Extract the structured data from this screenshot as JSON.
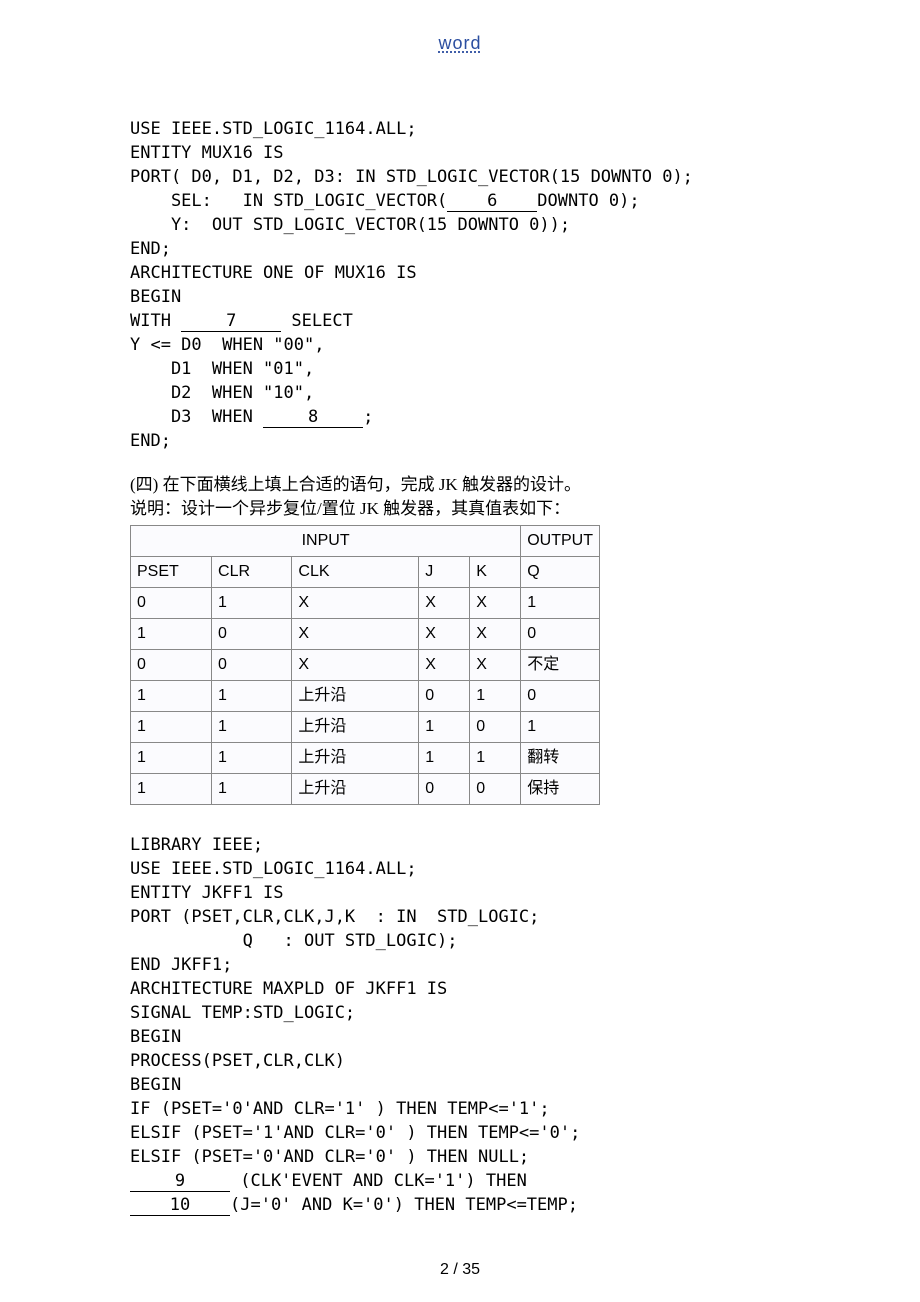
{
  "header": {
    "word": "word"
  },
  "code1": {
    "line1": "USE IEEE.STD_LOGIC_1164.ALL;",
    "line2": "ENTITY MUX16 IS",
    "line3a": "PORT( D0, D1, D2, D3: IN STD_LOGIC_VECTOR(15 DOWNTO 0);",
    "line4a": "    SEL:   IN STD_LOGIC_VECTOR(",
    "blank6": "6",
    "line4b": "DOWNTO 0);",
    "line5": "    Y:  OUT STD_LOGIC_VECTOR(15 DOWNTO 0));",
    "line6": "END;",
    "line7": "ARCHITECTURE ONE OF MUX16 IS",
    "line8": "BEGIN",
    "line9a": "WITH ",
    "blank7": "7",
    "line9b": " SELECT",
    "line10": "Y <= D0  WHEN \"00\",",
    "line11": "    D1  WHEN \"01\",",
    "line12": "    D2  WHEN \"10\",",
    "line13a": "    D3  WHEN ",
    "blank8": "8",
    "line13b": ";",
    "line14": "END;"
  },
  "section4": {
    "title": "(四) 在下面横线上填上合适的语句，完成 JK 触发器的设计。",
    "desc": "说明：设计一个异步复位/置位 JK 触发器，其真值表如下："
  },
  "table": {
    "head_input": "INPUT",
    "head_output": "OUTPUT",
    "cols": [
      "PSET",
      "CLR",
      "CLK",
      "J",
      "K",
      "Q"
    ],
    "rows": [
      [
        "0",
        "1",
        "X",
        "X",
        "X",
        "1"
      ],
      [
        "1",
        "0",
        "X",
        "X",
        "X",
        "0"
      ],
      [
        "0",
        "0",
        "X",
        "X",
        "X",
        "不定"
      ],
      [
        "1",
        "1",
        "上升沿",
        "0",
        "1",
        "0"
      ],
      [
        "1",
        "1",
        "上升沿",
        "1",
        "0",
        "1"
      ],
      [
        "1",
        "1",
        "上升沿",
        "1",
        "1",
        "翻转"
      ],
      [
        "1",
        "1",
        "上升沿",
        "0",
        "0",
        "保持"
      ]
    ]
  },
  "code2": {
    "line1": "LIBRARY IEEE;",
    "line2": "USE IEEE.STD_LOGIC_1164.ALL;",
    "line3": "ENTITY JKFF1 IS",
    "line4": "PORT (PSET,CLR,CLK,J,K  : IN  STD_LOGIC;",
    "line5": "           Q   : OUT STD_LOGIC);",
    "line6": "END JKFF1;",
    "line7": "ARCHITECTURE MAXPLD OF JKFF1 IS",
    "line8": "SIGNAL TEMP:STD_LOGIC;",
    "line9": "BEGIN",
    "line10": "PROCESS(PSET,CLR,CLK)",
    "line11": "BEGIN",
    "line12": "IF (PSET='0'AND CLR='1' ) THEN TEMP<='1';",
    "line13": "ELSIF (PSET='1'AND CLR='0' ) THEN TEMP<='0';",
    "line14": "ELSIF (PSET='0'AND CLR='0' ) THEN NULL;",
    "blank9": "9",
    "line15b": " (CLK'EVENT AND CLK='1') THEN",
    "blank10": "10",
    "line16b": "(J='0' AND K='0') THEN TEMP<=TEMP;"
  },
  "footer": {
    "page": "2 / 35"
  }
}
